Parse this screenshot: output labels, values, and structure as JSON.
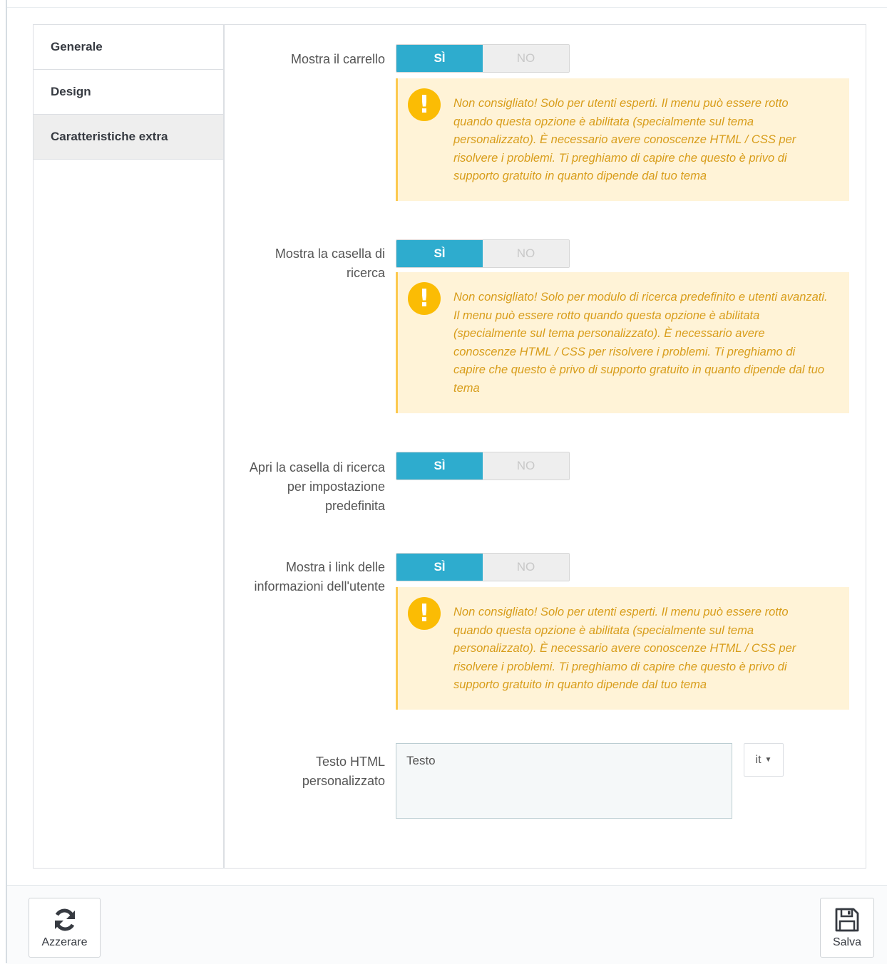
{
  "sidebar": {
    "items": [
      {
        "label": "Generale",
        "active": false
      },
      {
        "label": "Design",
        "active": false
      },
      {
        "label": "Caratteristiche extra",
        "active": true
      }
    ]
  },
  "toggle": {
    "yes_label": "SÌ",
    "no_label": "NO",
    "active_color": "#2eacce"
  },
  "settings": [
    {
      "label": "Mostra il carrello",
      "value": "SÌ",
      "warning": "Non consigliato! Solo per utenti esperti. Il menu può essere rotto quando questa opzione è abilitata (specialmente sul tema personalizzato). È necessario avere conoscenze HTML / CSS per risolvere i problemi. Ti preghiamo di capire che questo è privo di supporto gratuito in quanto dipende dal tuo tema"
    },
    {
      "label": "Mostra la casella di ricerca",
      "value": "SÌ",
      "warning": "Non consigliato! Solo per modulo di ricerca predefinito e utenti avanzati. Il menu può essere rotto quando questa opzione è abilitata (specialmente sul tema personalizzato). È necessario avere conoscenze HTML / CSS per risolvere i problemi. Ti preghiamo di capire che questo è privo di supporto gratuito in quanto dipende dal tuo tema"
    },
    {
      "label": "Apri la casella di ricerca per impostazione predefinita",
      "value": "SÌ"
    },
    {
      "label": "Mostra i link delle informazioni dell'utente",
      "value": "SÌ",
      "warning": "Non consigliato! Solo per utenti esperti. Il menu può essere rotto quando questa opzione è abilitata (specialmente sul tema personalizzato). È necessario avere conoscenze HTML / CSS per risolvere i problemi. Ti preghiamo di capire che questo è privo di supporto gratuito in quanto dipende dal tuo tema"
    }
  ],
  "custom_html": {
    "label": "Testo HTML personalizzato",
    "value": "Testo",
    "language": "it"
  },
  "footer": {
    "reset_label": "Azzerare",
    "save_label": "Salva"
  },
  "colors": {
    "warning_bg": "#fff3d7",
    "warning_text": "#d89d1b",
    "warning_icon": "#fbbc04"
  },
  "icons": [
    "exclamation-icon",
    "refresh-icon",
    "floppy-disk-icon",
    "caret-down-icon"
  ]
}
